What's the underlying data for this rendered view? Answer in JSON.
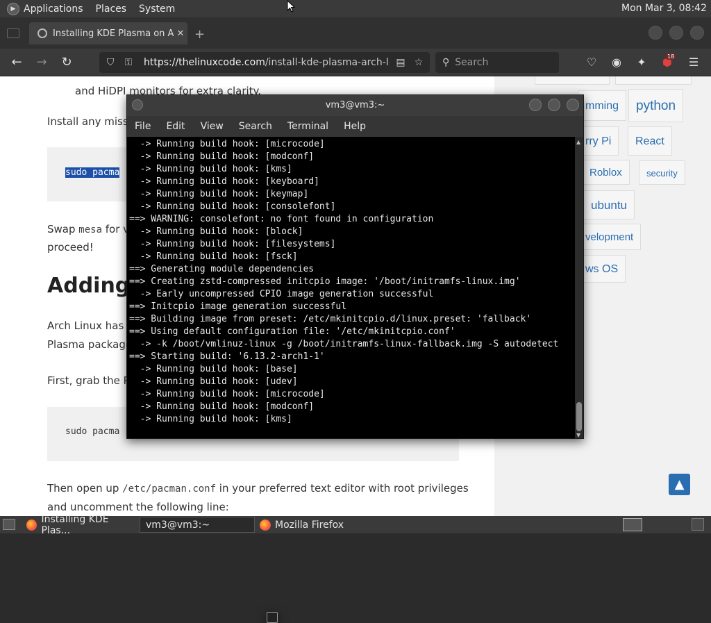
{
  "top_panel": {
    "menus": [
      "Applications",
      "Places",
      "System"
    ],
    "clock": "Mon Mar  3, 08:42"
  },
  "browser": {
    "tab_title": "Installing KDE Plasma on Ar",
    "tab_close": "✕",
    "new_tab": "+",
    "url_domain": "https://thelinuxcode.com",
    "url_path": "/install-kde-plasma-arch-linux/",
    "search_placeholder": "Search",
    "extension_badge": "18"
  },
  "article": {
    "fragment_top": "and HiDPI monitors for extra clarity.",
    "install_missing": "Install any missi",
    "code1": "sudo pacma",
    "swap_prefix": "Swap ",
    "swap_code": "mesa",
    "swap_rest": " for v",
    "proceed": "proceed!",
    "heading": "Adding",
    "arch_line1": "Arch Linux has a",
    "arch_line2": "Plasma package",
    "first_grab": "First, grab the P",
    "code2": "sudo pacma",
    "then_open_prefix": "Then open up ",
    "then_open_code": "/etc/pacman.conf",
    "then_open_rest": " in your preferred text editor with root privileges",
    "uncomment": "and uncomment the following line:"
  },
  "sidebar": {
    "tags": [
      "mming",
      "python",
      "rry Pi",
      "React",
      "Roblox",
      "security",
      "ubuntu",
      "velopment",
      "ws OS"
    ],
    "scroll_top": "▲"
  },
  "terminal": {
    "title": "vm3@vm3:~",
    "menu": [
      "File",
      "Edit",
      "View",
      "Search",
      "Terminal",
      "Help"
    ],
    "lines": [
      "  -> Running build hook: [microcode]",
      "  -> Running build hook: [modconf]",
      "  -> Running build hook: [kms]",
      "  -> Running build hook: [keyboard]",
      "  -> Running build hook: [keymap]",
      "  -> Running build hook: [consolefont]",
      "==> WARNING: consolefont: no font found in configuration",
      "  -> Running build hook: [block]",
      "  -> Running build hook: [filesystems]",
      "  -> Running build hook: [fsck]",
      "==> Generating module dependencies",
      "==> Creating zstd-compressed initcpio image: '/boot/initramfs-linux.img'",
      "  -> Early uncompressed CPIO image generation successful",
      "==> Initcpio image generation successful",
      "==> Building image from preset: /etc/mkinitcpio.d/linux.preset: 'fallback'",
      "==> Using default configuration file: '/etc/mkinitcpio.conf'",
      "  -> -k /boot/vmlinuz-linux -g /boot/initramfs-linux-fallback.img -S autodetect",
      "==> Starting build: '6.13.2-arch1-1'",
      "  -> Running build hook: [base]",
      "  -> Running build hook: [udev]",
      "  -> Running build hook: [microcode]",
      "  -> Running build hook: [modconf]",
      "  -> Running build hook: [kms]"
    ]
  },
  "taskbar": {
    "tasks": [
      "Installing KDE Plas...",
      "vm3@vm3:~",
      "Mozilla Firefox"
    ]
  },
  "colors": {
    "link": "#2a6db0",
    "selection": "#1b4fa8",
    "terminal_bg": "#000000"
  }
}
